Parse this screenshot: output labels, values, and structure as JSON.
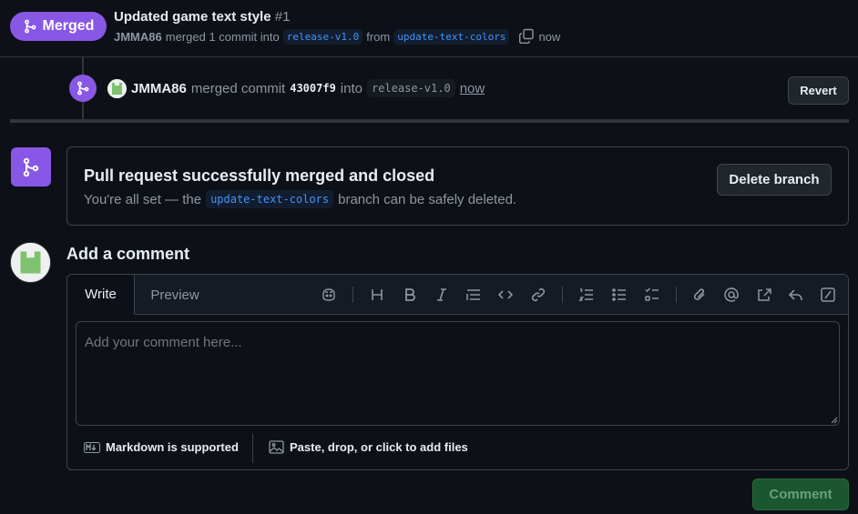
{
  "header": {
    "badge_label": "Merged",
    "title": "Updated game text style",
    "number": "#1",
    "author": "JMMA86",
    "merged_text": "merged 1 commit into",
    "base_branch": "release-v1.0",
    "from_text": "from",
    "head_branch": "update-text-colors",
    "time": "now"
  },
  "timeline": {
    "author": "JMMA86",
    "merged_commit_text": "merged commit",
    "sha": "43007f9",
    "into_text": "into",
    "branch": "release-v1.0",
    "time": "now",
    "revert_label": "Revert"
  },
  "merge_box": {
    "title": "Pull request successfully merged and closed",
    "sub_prefix": "You're all set — the",
    "branch": "update-text-colors",
    "sub_suffix": "branch can be safely deleted.",
    "delete_label": "Delete branch"
  },
  "comment": {
    "heading": "Add a comment",
    "tab_write": "Write",
    "tab_preview": "Preview",
    "placeholder": "Add your comment here...",
    "markdown_note": "Markdown is supported",
    "files_note": "Paste, drop, or click to add files",
    "submit_label": "Comment"
  },
  "colors": {
    "accent_merged": "#8957e5",
    "branch_text": "#4493f8",
    "comment_btn_bg": "#1a5630"
  },
  "icons": {
    "merge": "git-merge-icon",
    "copy": "copy-icon",
    "toolbar": [
      "copilot-icon",
      "heading-icon",
      "bold-icon",
      "italic-icon",
      "quote-icon",
      "code-icon",
      "link-icon",
      "numbered-list-icon",
      "bullet-list-icon",
      "task-list-icon",
      "attach-icon",
      "mention-icon",
      "reference-icon",
      "reply-icon",
      "slash-command-icon"
    ]
  }
}
